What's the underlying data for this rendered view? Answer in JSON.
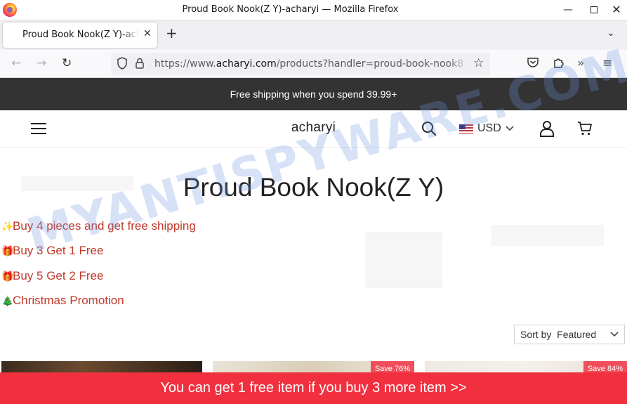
{
  "browser": {
    "window_title": "Proud Book Nook(Z Y)-acharyi — Mozilla Firefox",
    "tab_label": "Proud Book Nook(Z Y)-acharyi",
    "url_prefix": "https://www.",
    "url_domain": "acharyi.com",
    "url_path": "/products?handler=proud-book-nook8"
  },
  "site": {
    "announcement": "Free shipping when you spend 39.99+",
    "brand": "acharyi",
    "currency": "USD",
    "page_title": "Proud Book Nook(Z Y)",
    "promos": [
      {
        "emoji": "✨",
        "text": "Buy 4 pieces and get free shipping"
      },
      {
        "emoji": "🎁",
        "text": "Buy 3 Get 1 Free"
      },
      {
        "emoji": "🎁",
        "text": "Buy 5 Get 2 Free"
      },
      {
        "emoji": "🎄",
        "text": "Christmas Promotion"
      }
    ],
    "sort": {
      "label": "Sort by",
      "value": "Featured"
    },
    "products": [
      {
        "badge": ""
      },
      {
        "badge": "Save 76%"
      },
      {
        "badge": "Save 84%"
      }
    ],
    "bottom_banner": "You can get 1 free item if you buy 3 more item  >>"
  },
  "watermark": "MYANTISPYWARE.COM",
  "colors": {
    "announce_bg": "#333333",
    "promo_text": "#c0392b",
    "bottom_bar": "#f0303f",
    "save_badge": "#f04e5b"
  }
}
